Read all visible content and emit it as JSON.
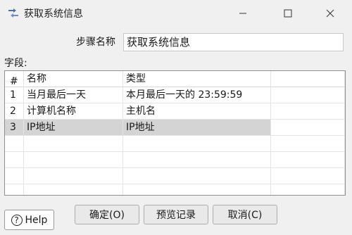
{
  "window": {
    "title": "获取系统信息"
  },
  "step": {
    "label": "步骤名称",
    "value": "获取系统信息"
  },
  "fields": {
    "label": "字段:",
    "columns": [
      "#",
      "名称",
      "类型",
      ""
    ],
    "rows": [
      {
        "num": "1",
        "name": "当月最后一天",
        "type": "本月最后一天的 23:59:59"
      },
      {
        "num": "2",
        "name": "计算机名称",
        "type": "主机名"
      },
      {
        "num": "3",
        "name": "IP地址",
        "type": "IP地址"
      }
    ],
    "selected_row": 3
  },
  "buttons": {
    "help": "Help",
    "ok": "确定(O)",
    "preview": "预览记录",
    "cancel": "取消(C)"
  }
}
